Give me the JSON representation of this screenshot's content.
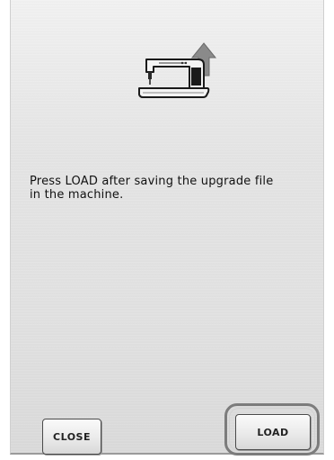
{
  "dialog": {
    "message": "Press LOAD after saving the upgrade file\nin the machine."
  },
  "icon": {
    "name": "sewing-machine-upgrade-icon"
  },
  "buttons": {
    "close_label": "CLOSE",
    "load_label": "LOAD"
  }
}
